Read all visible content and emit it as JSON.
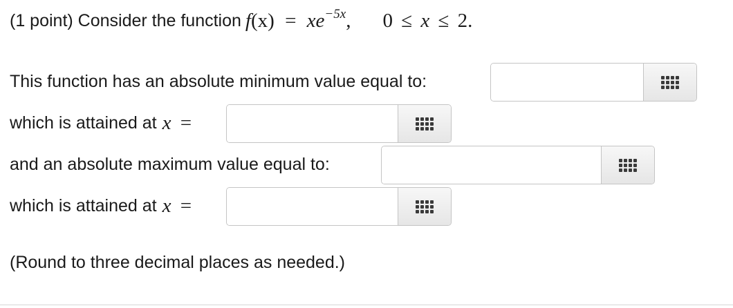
{
  "problem": {
    "intro": "(1 point) Consider the function",
    "func_name": "f",
    "func_arg": "(x)",
    "equals": "=",
    "expr_base": "xe",
    "expr_exponent": "−5x",
    "expr_comma": ",",
    "domain_zero": "0",
    "domain_le1": "≤",
    "domain_x": "x",
    "domain_le2": "≤",
    "domain_two": "2."
  },
  "questions": [
    {
      "label": "This function has an absolute minimum value equal to:",
      "math_var": "",
      "math_eq": "",
      "value": "",
      "placeholder": ""
    },
    {
      "label": "which is attained at",
      "math_var": "x",
      "math_eq": "=",
      "value": "",
      "placeholder": ""
    },
    {
      "label": "and an absolute maximum value equal to:",
      "math_var": "",
      "math_eq": "",
      "value": "",
      "placeholder": ""
    },
    {
      "label": "which is attained at",
      "math_var": "x",
      "math_eq": "=",
      "value": "",
      "placeholder": ""
    }
  ],
  "note": "(Round to three decimal places as needed.)"
}
